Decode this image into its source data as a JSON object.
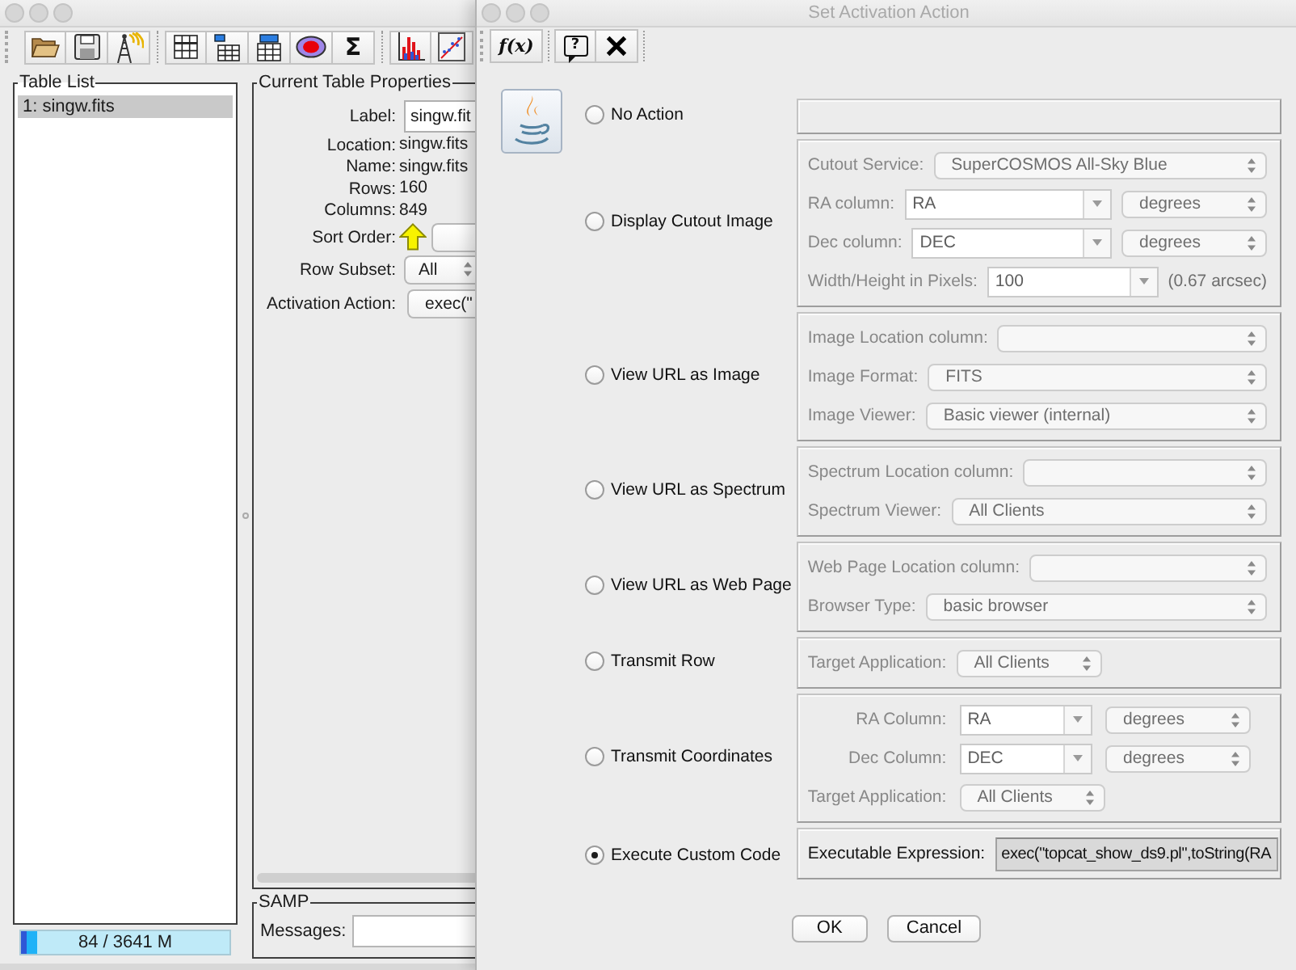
{
  "main_window": {
    "toolbar": [
      [
        {
          "kind": "open"
        },
        {
          "kind": "save"
        },
        {
          "kind": "broadcast"
        }
      ],
      [
        {
          "kind": "table"
        },
        {
          "kind": "columns"
        },
        {
          "kind": "header"
        },
        {
          "kind": "subsets"
        },
        {
          "kind": "stats",
          "glyph": "Σ"
        }
      ],
      [
        {
          "kind": "histogram"
        },
        {
          "kind": "plot"
        }
      ]
    ],
    "table_list": {
      "title": "Table List",
      "items": [
        {
          "label": "1: singw.fits",
          "selected": true
        }
      ]
    },
    "memory": {
      "text": "84 / 3641 M",
      "level": 0.08
    },
    "properties": {
      "title": "Current Table Properties",
      "rows": [
        {
          "label": "Label:",
          "kind": "input",
          "value": "singw.fit"
        },
        {
          "label": "Location:",
          "kind": "text",
          "value": "singw.fits"
        },
        {
          "label": "Name:",
          "kind": "text",
          "value": "singw.fits"
        },
        {
          "label": "Rows:",
          "kind": "text",
          "value": "160"
        },
        {
          "label": "Columns:",
          "kind": "text",
          "value": "849"
        },
        {
          "label": "Sort Order:",
          "kind": "sort"
        },
        {
          "label": "Row Subset:",
          "kind": "select",
          "value": "All"
        },
        {
          "label": "Activation Action:",
          "kind": "button",
          "value": "exec(\""
        }
      ]
    },
    "samp": {
      "title": "SAMP",
      "label": "Messages:"
    }
  },
  "dialog": {
    "title": "Set Activation Action",
    "toolbar": [
      {
        "kind": "function",
        "glyph": "f(x)"
      },
      {
        "kind": "help",
        "glyph": "?"
      },
      {
        "kind": "close"
      }
    ],
    "actions": [
      {
        "label": "No Action",
        "selected": false
      },
      {
        "label": "Display Cutout Image",
        "selected": false,
        "rows": [
          {
            "label": "Cutout Service:",
            "controls": [
              {
                "kind": "select",
                "value": "SuperCOSMOS All-Sky Blue"
              }
            ]
          },
          {
            "label": "RA column:",
            "controls": [
              {
                "kind": "combo",
                "value": "RA"
              },
              {
                "kind": "small_select",
                "value": "degrees"
              }
            ]
          },
          {
            "label": "Dec column:",
            "controls": [
              {
                "kind": "combo",
                "value": "DEC"
              },
              {
                "kind": "small_select",
                "value": "degrees"
              }
            ]
          },
          {
            "label": "Width/Height in Pixels:",
            "controls": [
              {
                "kind": "combo",
                "value": "100"
              },
              {
                "kind": "note",
                "text": "(0.67 arcsec)"
              }
            ]
          }
        ]
      },
      {
        "label": "View URL as Image",
        "selected": false,
        "rows": [
          {
            "label": "Image Location column:",
            "controls": [
              {
                "kind": "select"
              }
            ]
          },
          {
            "label": "Image Format:",
            "controls": [
              {
                "kind": "select",
                "value": "FITS"
              }
            ]
          },
          {
            "label": "Image Viewer:",
            "controls": [
              {
                "kind": "select",
                "value": "Basic viewer (internal)"
              }
            ]
          }
        ]
      },
      {
        "label": "View URL as Spectrum",
        "selected": false,
        "rows": [
          {
            "label": "Spectrum Location column:",
            "controls": [
              {
                "kind": "select"
              }
            ]
          },
          {
            "label": "Spectrum Viewer:",
            "controls": [
              {
                "kind": "select",
                "value": "All Clients"
              }
            ]
          }
        ]
      },
      {
        "label": "View URL as Web Page",
        "selected": false,
        "rows": [
          {
            "label": "Web Page Location column:",
            "controls": [
              {
                "kind": "select"
              }
            ]
          },
          {
            "label": "Browser Type:",
            "controls": [
              {
                "kind": "select",
                "value": "basic browser"
              }
            ]
          }
        ]
      },
      {
        "label": "Transmit Row",
        "selected": false,
        "rows": [
          {
            "label": "Target Application:",
            "controls": [
              {
                "kind": "small_select",
                "value": "All Clients"
              }
            ]
          }
        ]
      },
      {
        "label": "Transmit Coordinates",
        "selected": false,
        "labels_aligned": true,
        "rows": [
          {
            "label": "RA Column:",
            "controls": [
              {
                "kind": "combo",
                "value": "RA"
              },
              {
                "kind": "small_select",
                "value": "degrees"
              }
            ]
          },
          {
            "label": "Dec Column:",
            "controls": [
              {
                "kind": "combo",
                "value": "DEC"
              },
              {
                "kind": "small_select",
                "value": "degrees"
              }
            ]
          },
          {
            "label": "Target Application:",
            "controls": [
              {
                "kind": "small_select",
                "value": "All Clients"
              }
            ]
          }
        ]
      },
      {
        "label": "Execute Custom Code",
        "selected": true,
        "rows": [
          {
            "label": "Executable Expression:",
            "controls": [
              {
                "kind": "text_field",
                "value": "exec(\"topcat_show_ds9.pl\",toString(RA"
              }
            ]
          }
        ]
      }
    ],
    "buttons": [
      "OK",
      "Cancel"
    ]
  }
}
